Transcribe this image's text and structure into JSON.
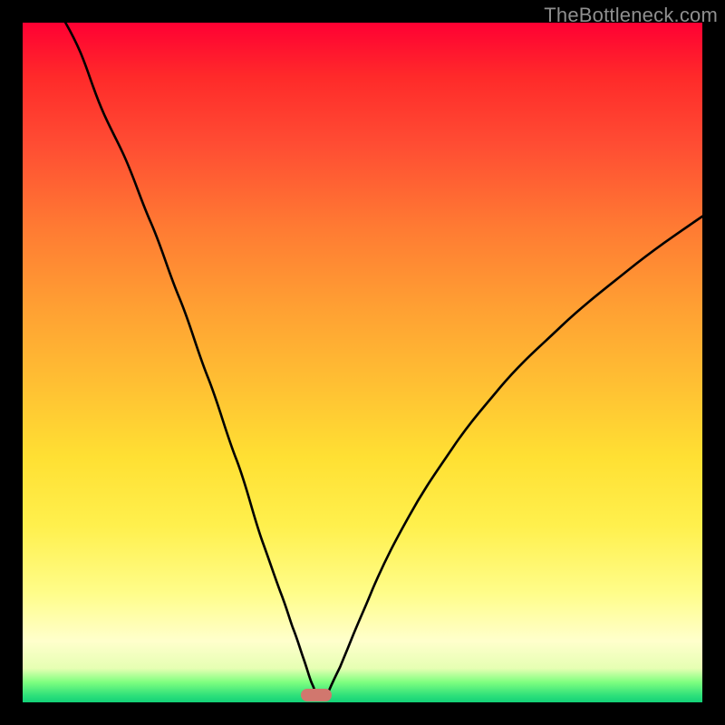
{
  "watermark": "TheBottleneck.com",
  "marker": {
    "x_frac": 0.432,
    "y_frac": 0.989
  },
  "chart_data": {
    "type": "line",
    "title": "",
    "xlabel": "",
    "ylabel": "",
    "xlim": [
      0,
      100
    ],
    "ylim": [
      0,
      100
    ],
    "curves": [
      {
        "name": "curve-left-descending",
        "x": [
          6.3,
          10.4,
          14.7,
          18.9,
          23.1,
          27.3,
          31.5,
          35.3,
          37.9,
          39.7,
          41.3,
          42.5,
          43.2
        ],
        "y_from_top": [
          0.0,
          9.5,
          19.1,
          29.5,
          40.6,
          52.3,
          64.4,
          76.4,
          83.7,
          88.9,
          93.5,
          97.1,
          98.9
        ]
      },
      {
        "name": "curve-right-ascending",
        "x": [
          45.1,
          46.7,
          48.5,
          51.5,
          56.8,
          63.1,
          70.3,
          79.2,
          89.1,
          100.0
        ],
        "y_from_top": [
          98.2,
          94.8,
          90.4,
          83.3,
          72.7,
          62.8,
          53.6,
          44.7,
          36.4,
          28.5
        ]
      }
    ],
    "gradient_description": "red at top → orange → yellow → pale yellow → light green → green at bottom",
    "marker_region": {
      "x_frac": 0.432,
      "y_frac": 0.989,
      "shape": "pill",
      "color": "#d1776e"
    }
  }
}
